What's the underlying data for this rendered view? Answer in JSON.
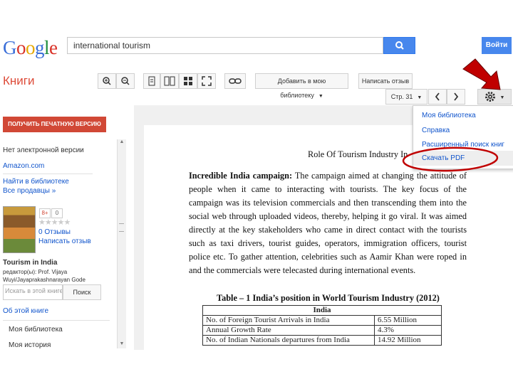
{
  "header": {
    "logo_letters": [
      "G",
      "o",
      "o",
      "g",
      "l",
      "e"
    ],
    "search_value": "international tourism",
    "login_label": "Войти"
  },
  "section_title": "Книги",
  "toolbar": {
    "add_to_library_label": "Добавить в мою библиотеку",
    "write_review_label": "Написать отзыв",
    "page_label": "Стр. 31"
  },
  "settings_menu": {
    "items": [
      "Моя библиотека",
      "Справка",
      "Расширенный поиск книг",
      "Скачать PDF"
    ]
  },
  "sidebar": {
    "print_button": "ПОЛУЧИТЬ ПЕЧАТНУЮ ВЕРСИЮ",
    "no_ebook": "Нет электронной версии",
    "amazon": "Amazon.com",
    "find_library": "Найти в библиотеке",
    "all_sellers": "Все продавцы »",
    "plus_one": "8+",
    "plus_count": "0",
    "stars": "★★★★★",
    "reviews": "0 Отзывы",
    "write_review": "Написать отзыв",
    "book_title": "Tourism in India",
    "editors_line": "редактор(ы): Prof. Vijaya",
    "editors_line2": "Wuyi/Jayaprakashnarayan Gode",
    "search_placeholder": "Искать в этой книге",
    "search_button": "Поиск",
    "about_book": "Об этой книге",
    "my_library": "Моя библиотека",
    "my_history": "Моя история"
  },
  "document": {
    "heading": "Role Of Tourism Industry In",
    "paragraph_lead": "Incredible India campaign:",
    "paragraph": " The campaign aimed at changing the attitude of people when it came to interacting with tourists. The key focus of the campaign was its television commercials and then transcending them into the social web through uploaded videos, thereby, helping it go viral. It was aimed directly at the key stakeholders who came in direct contact with the tourists such as taxi drivers, tourist guides, operators, immigration officers, tourist police etc. To gather attention, celebrities such as Aamir Khan were roped in and the commercials were telecasted during international events.",
    "table_caption": "Table – 1 India’s position in World Tourism Industry (2012)",
    "table_header": "India",
    "rows": [
      {
        "label": "No. of Foreign Tourist Arrivals in India",
        "value": "6.55 Million"
      },
      {
        "label": "Annual Growth Rate",
        "value": "4.3%"
      },
      {
        "label": "No. of Indian Nationals departures from India",
        "value": "14.92 Million"
      }
    ]
  },
  "colors": {
    "accent_blue": "#4787ed",
    "print_red": "#d14836",
    "annotation_red": "#c00000",
    "link_blue": "#1155cc"
  }
}
